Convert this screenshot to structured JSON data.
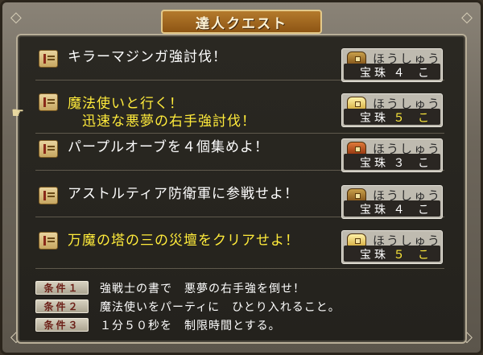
{
  "title": "達人クエスト",
  "quests": [
    {
      "lines": [
        "キラーマジンガ強討伐！"
      ],
      "highlight": false,
      "reward": {
        "label": "ほうしゅう",
        "item": "宝珠",
        "count": "４ こ",
        "chest": "normal"
      }
    },
    {
      "lines": [
        "魔法使いと行く！",
        "　迅速な悪夢の右手強討伐！"
      ],
      "highlight": true,
      "reward": {
        "label": "ほうしゅう",
        "item": "宝珠",
        "count": "５ こ",
        "chest": "gold"
      }
    },
    {
      "lines": [
        "パープルオーブを４個集めよ！"
      ],
      "highlight": false,
      "reward": {
        "label": "ほうしゅう",
        "item": "宝珠",
        "count": "３ こ",
        "chest": "red"
      }
    },
    {
      "lines": [
        "アストルティア防衛軍に参戦せよ！"
      ],
      "highlight": false,
      "reward": {
        "label": "ほうしゅう",
        "item": "宝珠",
        "count": "４ こ",
        "chest": "normal"
      }
    },
    {
      "lines": [
        "万魔の塔の三の災壇をクリアせよ！"
      ],
      "highlight": true,
      "reward": {
        "label": "ほうしゅう",
        "item": "宝珠",
        "count": "５ こ",
        "chest": "gold"
      }
    }
  ],
  "conditions": [
    {
      "badge": "条件１",
      "text": "強戦士の書で　悪夢の右手強を倒せ！"
    },
    {
      "badge": "条件２",
      "text": "魔法使いをパーティに　ひとり入れること。"
    },
    {
      "badge": "条件３",
      "text": "１分５０秒を　制限時間とする。"
    }
  ],
  "icons": {
    "quest": "scroll-icon",
    "reward": "treasure-chest-icon",
    "cursor": "pointer-hand-icon"
  },
  "colors": {
    "highlight_text": "#ffeb3b",
    "normal_text": "#ffffff"
  }
}
